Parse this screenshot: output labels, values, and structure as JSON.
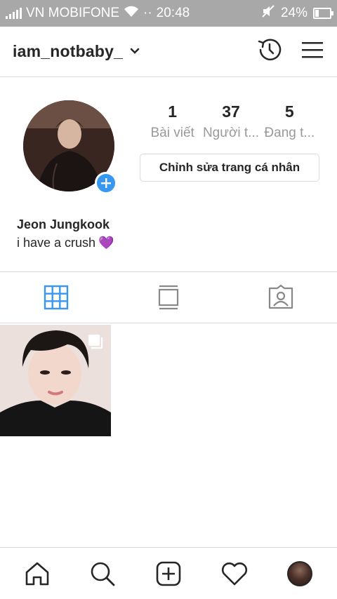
{
  "status_bar": {
    "carrier": "VN MOBIFONE",
    "dots": "··",
    "time": "20:48",
    "battery": "24%",
    "battery_level": 0.24
  },
  "header": {
    "username": "iam_notbaby_"
  },
  "profile": {
    "stats": [
      {
        "value": "1",
        "label": "Bài viết"
      },
      {
        "value": "37",
        "label": "Người t..."
      },
      {
        "value": "5",
        "label": "Đang t..."
      }
    ],
    "edit_button": "Chỉnh sửa trang cá nhân",
    "full_name": "Jeon Jungkook",
    "bio": "i have a crush",
    "bio_emoji": "💜"
  },
  "colors": {
    "accent": "#3897f0",
    "status_bar": "#a8a8a8",
    "text": "#262626",
    "muted": "#999999",
    "border": "#dbdbdb"
  },
  "tabs": [
    {
      "icon": "grid-icon",
      "active": true
    },
    {
      "icon": "feed-icon",
      "active": false
    },
    {
      "icon": "tagged-icon",
      "active": false
    }
  ],
  "nav": [
    {
      "icon": "home-icon"
    },
    {
      "icon": "search-icon"
    },
    {
      "icon": "add-post-icon"
    },
    {
      "icon": "heart-icon"
    },
    {
      "icon": "profile-avatar"
    }
  ]
}
